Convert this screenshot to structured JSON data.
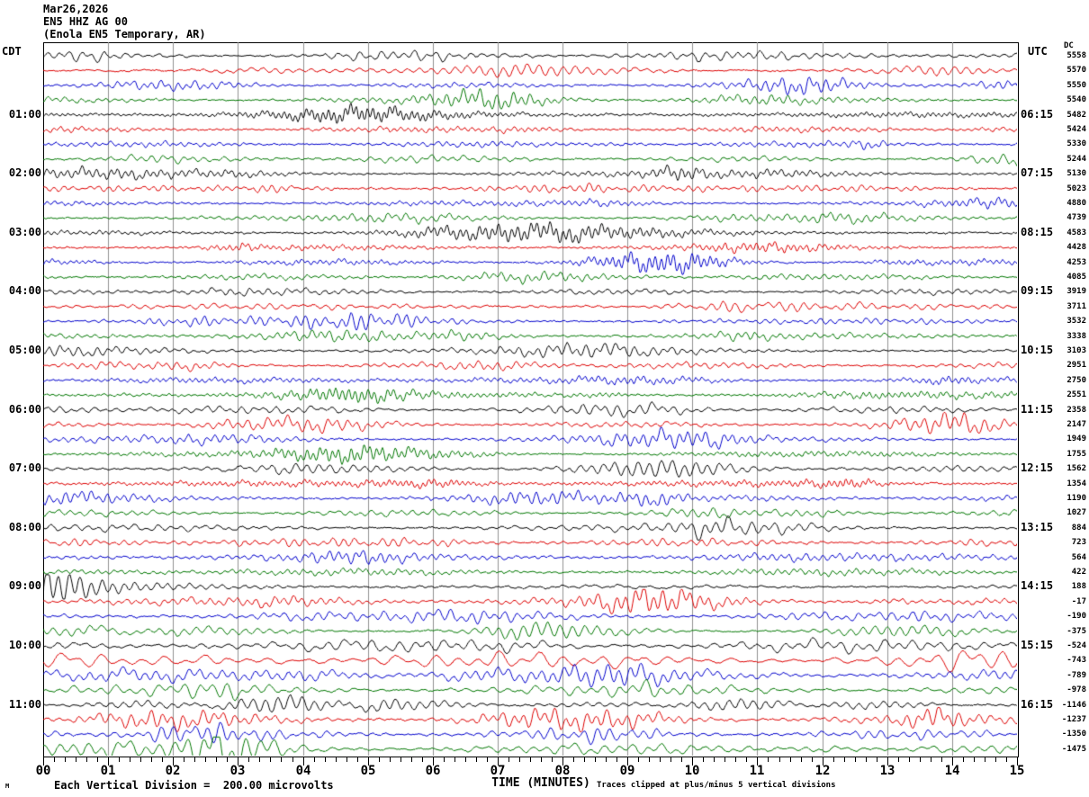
{
  "header": {
    "date": "Mar26,2026",
    "station": "EN5 HHZ AG 00",
    "station_desc": "(Enola EN5 Temporary, AR)"
  },
  "axes": {
    "left_label": "CDT",
    "right_label": "UTC",
    "dc_label": "DC",
    "x_title": "TIME (MINUTES)"
  },
  "footer": {
    "scale_note": "Each Vertical Division =  200.00 microvolts",
    "clip_note": "Traces clipped at plus/minus 5 vertical divisions",
    "watermark": "M"
  },
  "chart_data": {
    "type": "line",
    "subtype": "helicorder-seismogram",
    "title": "EN5 HHZ AG 00 (Enola EN5 Temporary, AR) Mar26,2026",
    "xlabel": "TIME (MINUTES)",
    "x_range_minutes": [
      0,
      15
    ],
    "x_tick_labels": [
      "00",
      "01",
      "02",
      "03",
      "04",
      "05",
      "06",
      "07",
      "08",
      "09",
      "10",
      "11",
      "12",
      "13",
      "14",
      "15"
    ],
    "minor_ticks_per_minute": 6,
    "grid": "vertical-minute-lines",
    "grid_color": "#909090",
    "trace_colors_cycle": [
      "#000000",
      "#dd0000",
      "#0000cc",
      "#007700"
    ],
    "rows": [
      {
        "cdt": "",
        "utc": "",
        "dc": "5558",
        "amp": 3.0
      },
      {
        "cdt": "",
        "utc": "",
        "dc": "5570",
        "amp": 3.0
      },
      {
        "cdt": "",
        "utc": "",
        "dc": "5550",
        "amp": 3.0
      },
      {
        "cdt": "",
        "utc": "",
        "dc": "5540",
        "amp": 3.0
      },
      {
        "cdt": "01:00",
        "utc": "06:15",
        "dc": "5482",
        "amp": 3.0
      },
      {
        "cdt": "",
        "utc": "",
        "dc": "5424",
        "amp": 3.0
      },
      {
        "cdt": "",
        "utc": "",
        "dc": "5330",
        "amp": 3.0
      },
      {
        "cdt": "",
        "utc": "",
        "dc": "5244",
        "amp": 3.0
      },
      {
        "cdt": "02:00",
        "utc": "07:15",
        "dc": "5130",
        "amp": 3.2
      },
      {
        "cdt": "",
        "utc": "",
        "dc": "5023",
        "amp": 3.0
      },
      {
        "cdt": "",
        "utc": "",
        "dc": "4880",
        "amp": 3.0
      },
      {
        "cdt": "",
        "utc": "",
        "dc": "4739",
        "amp": 3.0
      },
      {
        "cdt": "03:00",
        "utc": "08:15",
        "dc": "4583",
        "amp": 3.0
      },
      {
        "cdt": "",
        "utc": "",
        "dc": "4428",
        "amp": 3.0
      },
      {
        "cdt": "",
        "utc": "",
        "dc": "4253",
        "amp": 3.2
      },
      {
        "cdt": "",
        "utc": "",
        "dc": "4085",
        "amp": 3.0
      },
      {
        "cdt": "04:00",
        "utc": "09:15",
        "dc": "3919",
        "amp": 3.0
      },
      {
        "cdt": "",
        "utc": "",
        "dc": "3711",
        "amp": 3.0
      },
      {
        "cdt": "",
        "utc": "",
        "dc": "3532",
        "amp": 3.0
      },
      {
        "cdt": "",
        "utc": "",
        "dc": "3338",
        "amp": 3.0
      },
      {
        "cdt": "05:00",
        "utc": "10:15",
        "dc": "3103",
        "amp": 3.2
      },
      {
        "cdt": "",
        "utc": "",
        "dc": "2951",
        "amp": 3.0
      },
      {
        "cdt": "",
        "utc": "",
        "dc": "2750",
        "amp": 3.0
      },
      {
        "cdt": "",
        "utc": "",
        "dc": "2551",
        "amp": 3.2
      },
      {
        "cdt": "06:00",
        "utc": "11:15",
        "dc": "2358",
        "amp": 3.6
      },
      {
        "cdt": "",
        "utc": "",
        "dc": "2147",
        "amp": 3.4
      },
      {
        "cdt": "",
        "utc": "",
        "dc": "1949",
        "amp": 3.2
      },
      {
        "cdt": "",
        "utc": "",
        "dc": "1755",
        "amp": 3.2
      },
      {
        "cdt": "07:00",
        "utc": "12:15",
        "dc": "1562",
        "amp": 3.6
      },
      {
        "cdt": "",
        "utc": "",
        "dc": "1354",
        "amp": 3.5
      },
      {
        "cdt": "",
        "utc": "",
        "dc": "1190",
        "amp": 3.5
      },
      {
        "cdt": "",
        "utc": "",
        "dc": "1027",
        "amp": 3.5
      },
      {
        "cdt": "08:00",
        "utc": "13:15",
        "dc": "884",
        "amp": 3.8
      },
      {
        "cdt": "",
        "utc": "",
        "dc": "723",
        "amp": 4.0
      },
      {
        "cdt": "",
        "utc": "",
        "dc": "564",
        "amp": 3.8
      },
      {
        "cdt": "",
        "utc": "",
        "dc": "422",
        "amp": 3.8
      },
      {
        "cdt": "09:00",
        "utc": "14:15",
        "dc": "188",
        "amp": 4.0
      },
      {
        "cdt": "",
        "utc": "",
        "dc": "-17",
        "amp": 4.3
      },
      {
        "cdt": "",
        "utc": "",
        "dc": "-190",
        "amp": 4.2
      },
      {
        "cdt": "",
        "utc": "",
        "dc": "-375",
        "amp": 4.0
      },
      {
        "cdt": "10:00",
        "utc": "15:15",
        "dc": "-524",
        "amp": 7.0
      },
      {
        "cdt": "",
        "utc": "",
        "dc": "-743",
        "amp": 8.5
      },
      {
        "cdt": "",
        "utc": "",
        "dc": "-789",
        "amp": 7.5
      },
      {
        "cdt": "",
        "utc": "",
        "dc": "-978",
        "amp": 6.0
      },
      {
        "cdt": "11:00",
        "utc": "16:15",
        "dc": "-1146",
        "amp": 5.2
      },
      {
        "cdt": "",
        "utc": "",
        "dc": "-1237",
        "amp": 5.5
      },
      {
        "cdt": "",
        "utc": "",
        "dc": "-1350",
        "amp": 5.0
      },
      {
        "cdt": "",
        "utc": "",
        "dc": "-1475",
        "amp": 6.0
      }
    ]
  }
}
